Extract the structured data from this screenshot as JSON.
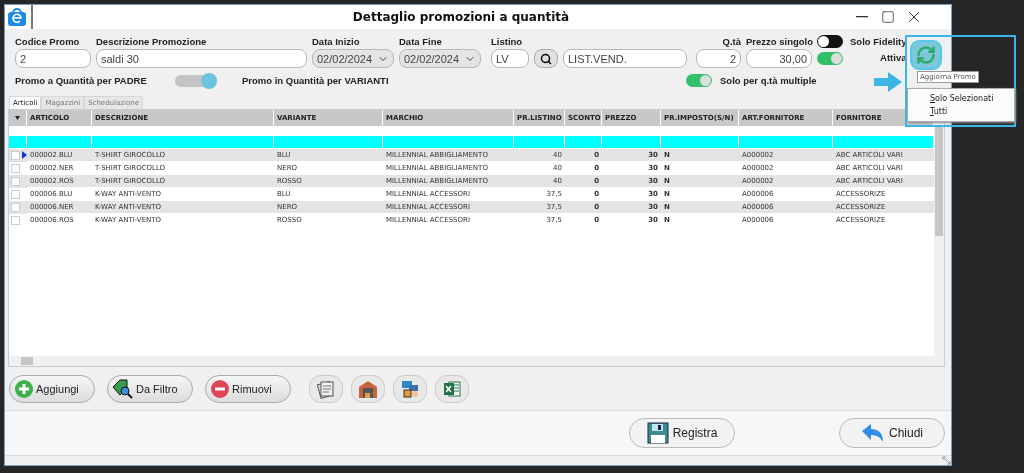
{
  "window": {
    "title": "Dettaglio promozioni a quantità"
  },
  "form": {
    "codice_promo": {
      "label": "Codice Promo",
      "value": "2"
    },
    "descrizione": {
      "label": "Descrizione Promozione",
      "value": "saldi 30"
    },
    "data_inizio": {
      "label": "Data Inizio",
      "value": "02/02/2024"
    },
    "data_fine": {
      "label": "Data Fine",
      "value": "02/02/2024"
    },
    "listino": {
      "label": "Listino",
      "code": "LV",
      "description": "LIST.VEND."
    },
    "qta": {
      "label": "Q.tà",
      "value": "2"
    },
    "prezzo_singolo": {
      "label": "Prezzo singolo",
      "value": "30,00"
    },
    "solo_fidelity": {
      "label": "Solo Fidelity",
      "on": false
    },
    "attiva": {
      "label": "Attiva",
      "on": true
    },
    "promo_mode": {
      "left_label": "Promo a Quantità per PADRE",
      "right_label": "Promo in Quantità per VARIANTI",
      "on": true
    },
    "solo_multiple": {
      "label": "Solo per q.tà multiple",
      "on": true
    }
  },
  "tabs": [
    {
      "label": "Articoli",
      "selected": true
    },
    {
      "label": "Magazzini",
      "selected": false
    },
    {
      "label": "Schedulazione",
      "selected": false
    }
  ],
  "table": {
    "columns": [
      {
        "label": "ARTICOLO",
        "kind": "text"
      },
      {
        "label": "DESCRIZIONE",
        "kind": "text"
      },
      {
        "label": "VARIANTE",
        "kind": "text"
      },
      {
        "label": "MARCHIO",
        "kind": "text"
      },
      {
        "label": "PR.LISTINO",
        "kind": "number"
      },
      {
        "label": "SCONTO",
        "kind": "strong-number"
      },
      {
        "label": "PREZZO",
        "kind": "strong-number"
      },
      {
        "label": "PR.IMPOSTO(S/N)",
        "kind": "flag"
      },
      {
        "label": "ART.FORNITORE",
        "kind": "text"
      },
      {
        "label": "FORNITORE",
        "kind": "text"
      }
    ],
    "rows": [
      {
        "checked": false,
        "current": true,
        "cells": [
          "000002.BLU",
          "T-SHIRT GIROCOLLO",
          "BLU",
          "MILLENNIAL ABBIGLIAMENTO",
          "40",
          "0",
          "30",
          "N",
          "A000002",
          "ABC ARTICOLI VARI"
        ]
      },
      {
        "checked": false,
        "current": false,
        "cells": [
          "000002.NER",
          "T-SHIRT GIROCOLLO",
          "NERO",
          "MILLENNIAL ABBIGLIAMENTO",
          "40",
          "0",
          "30",
          "N",
          "A000002",
          "ABC ARTICOLI VARI"
        ]
      },
      {
        "checked": false,
        "current": false,
        "cells": [
          "000002.ROS",
          "T-SHIRT GIROCOLLO",
          "ROSSO",
          "MILLENNIAL ABBIGLIAMENTO",
          "40",
          "0",
          "30",
          "N",
          "A000002",
          "ABC ARTICOLI VARI"
        ]
      },
      {
        "checked": false,
        "current": false,
        "cells": [
          "000006.BLU",
          "K-WAY ANTI-VENTO",
          "BLU",
          "MILLENNIAL ACCESSORI",
          "37,5",
          "0",
          "30",
          "N",
          "A000006",
          "ACCESSORIZE"
        ]
      },
      {
        "checked": false,
        "current": false,
        "cells": [
          "000006.NER",
          "K-WAY ANTI-VENTO",
          "NERO",
          "MILLENNIAL ACCESSORI",
          "37,5",
          "0",
          "30",
          "N",
          "A000006",
          "ACCESSORIZE"
        ]
      },
      {
        "checked": false,
        "current": false,
        "cells": [
          "000006.ROS",
          "K-WAY ANTI-VENTO",
          "ROSSO",
          "MILLENNIAL ACCESSORI",
          "37,5",
          "0",
          "30",
          "N",
          "A000006",
          "ACCESSORIZE"
        ]
      }
    ]
  },
  "actions": [
    {
      "label": "Aggiungi",
      "kind": "add"
    },
    {
      "label": "Da Filtro",
      "kind": "filter"
    },
    {
      "label": "Rimuovi",
      "kind": "remove"
    }
  ],
  "tool_buttons": [
    {
      "kind": "documents"
    },
    {
      "kind": "warehouse"
    },
    {
      "kind": "boards"
    },
    {
      "kind": "excel"
    }
  ],
  "footer_buttons": [
    {
      "label": "Registra",
      "kind": "save"
    },
    {
      "label": "Chiudi",
      "kind": "back"
    }
  ],
  "callout": {
    "tooltip": "Aggiorna Promo",
    "menu": [
      "Solo Selezionati",
      "Tutti"
    ]
  }
}
